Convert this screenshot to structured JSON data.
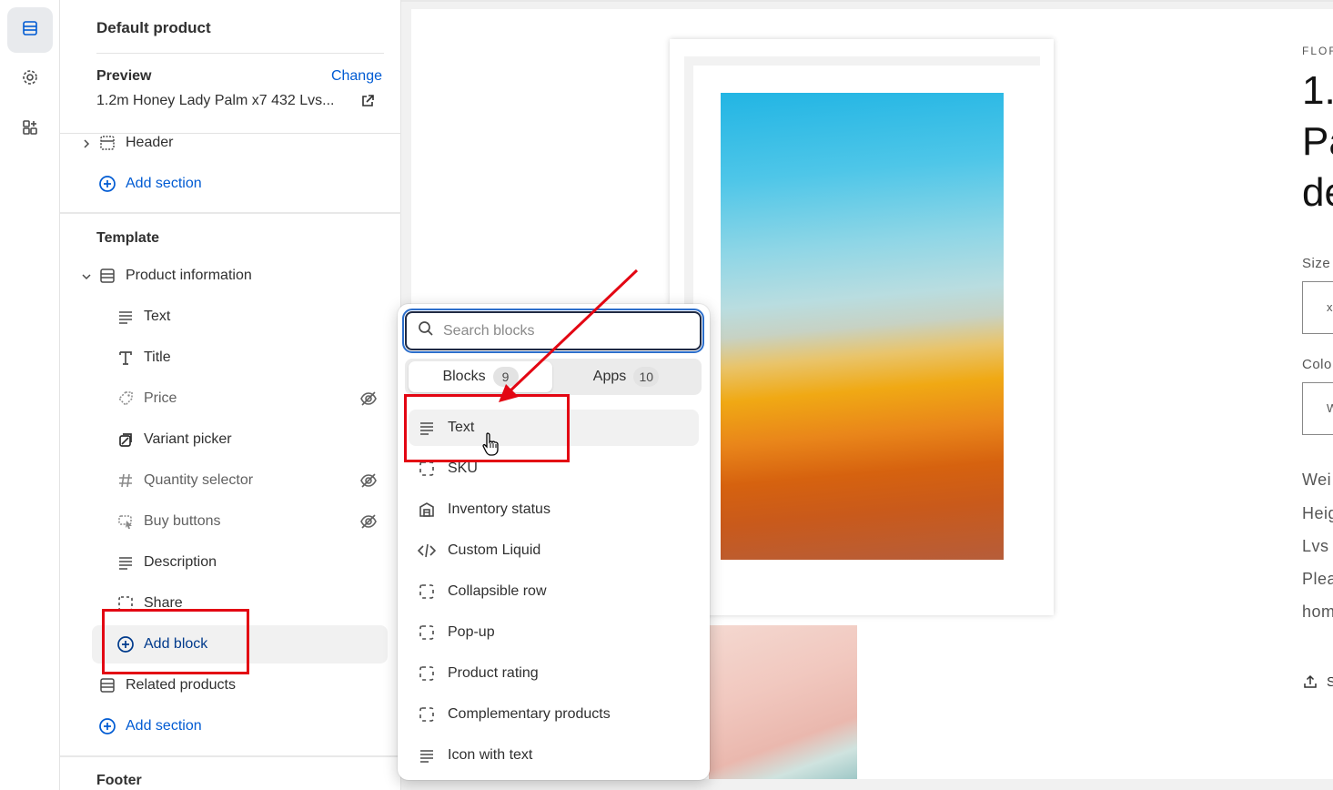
{
  "sidebar": {
    "title": "Default product",
    "preview_label": "Preview",
    "change_label": "Change",
    "preview_value": "1.2m Honey Lady Palm x7 432 Lvs...",
    "header_label": "Header",
    "add_section_1": "Add section",
    "template_heading": "Template",
    "product_information": "Product information",
    "blocks": [
      {
        "label": "Text",
        "icon": "text-lines-icon",
        "hidden": false
      },
      {
        "label": "Title",
        "icon": "title-t-icon",
        "hidden": false
      },
      {
        "label": "Price",
        "icon": "price-tag-icon",
        "hidden": true
      },
      {
        "label": "Variant picker",
        "icon": "variant-icon",
        "hidden": false
      },
      {
        "label": "Quantity selector",
        "icon": "hash-icon",
        "hidden": true
      },
      {
        "label": "Buy buttons",
        "icon": "cursor-click-icon",
        "hidden": true
      },
      {
        "label": "Description",
        "icon": "text-lines-icon",
        "hidden": false
      },
      {
        "label": "Share",
        "icon": "dashed-square-icon",
        "hidden": false
      }
    ],
    "add_block_label": "Add block",
    "related_products": "Related products",
    "add_section_2": "Add section",
    "footer_heading": "Footer"
  },
  "popover": {
    "search_placeholder": "Search blocks",
    "tabs": [
      {
        "label": "Blocks",
        "count": "9"
      },
      {
        "label": "Apps",
        "count": "10"
      }
    ],
    "items": [
      {
        "label": "Text",
        "icon": "text-lines-icon"
      },
      {
        "label": "SKU",
        "icon": "dashed-square-icon"
      },
      {
        "label": "Inventory status",
        "icon": "warehouse-icon"
      },
      {
        "label": "Custom Liquid",
        "icon": "code-icon"
      },
      {
        "label": "Collapsible row",
        "icon": "dashed-square-icon"
      },
      {
        "label": "Pop-up",
        "icon": "dashed-square-icon"
      },
      {
        "label": "Product rating",
        "icon": "dashed-square-icon"
      },
      {
        "label": "Complementary products",
        "icon": "dashed-square-icon"
      },
      {
        "label": "Icon with text",
        "icon": "text-lines-icon"
      }
    ]
  },
  "product_preview": {
    "vendor": "FLOR",
    "title_lines": [
      "1.",
      "Pa",
      "de"
    ],
    "size_label": "Size",
    "size_value": "x",
    "color_label": "Colo",
    "color_value": "W",
    "description_lines": [
      "Wei",
      "Heig",
      "Lvs",
      "Plea",
      "hom"
    ],
    "share_label": "S"
  },
  "colors": {
    "accent_blue": "#005bd3",
    "annotation_red": "#e30613"
  }
}
